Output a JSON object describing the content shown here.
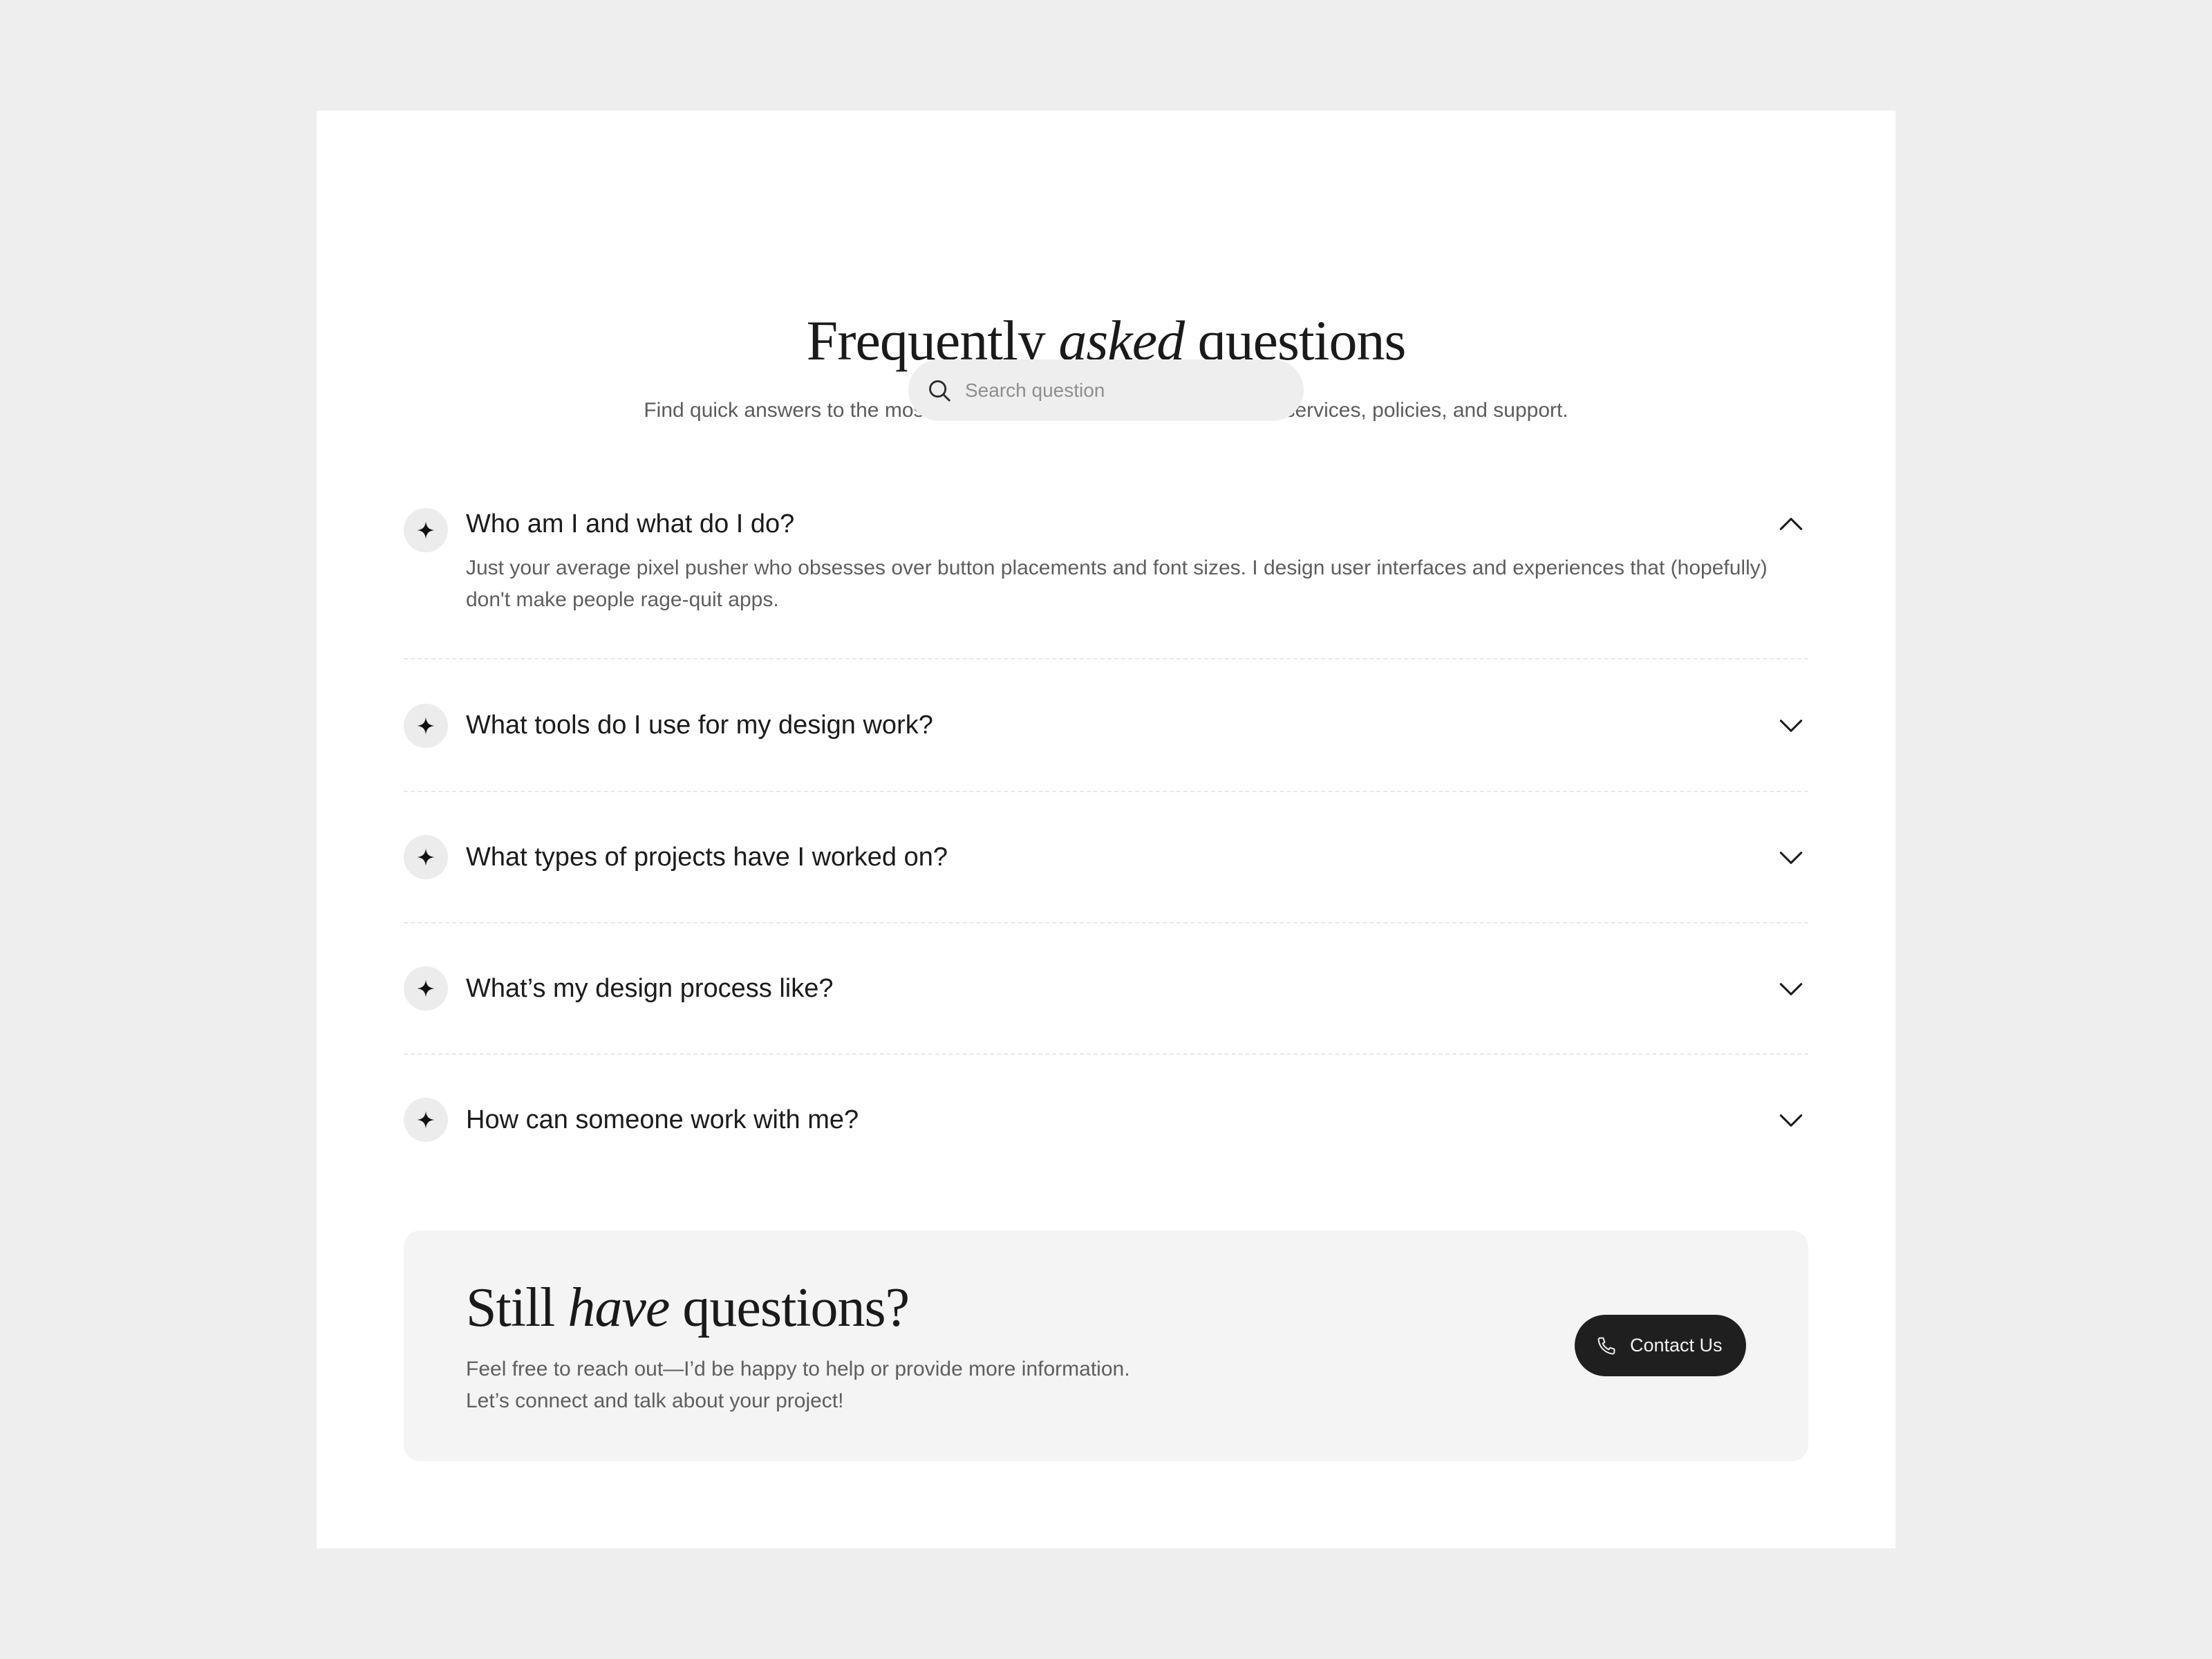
{
  "hero": {
    "title_pre": "Frequently ",
    "title_em": "asked",
    "title_post": " questions",
    "subtitle": "Find quick answers to the most commonly asked questions about our services, policies, and support."
  },
  "search": {
    "placeholder": "Search question",
    "icon": "search-icon"
  },
  "faq": {
    "item_icon": "sparkle-icon",
    "items": [
      {
        "question": "Who am I and what do I do?",
        "expanded": true,
        "answer": "Just your average pixel pusher who obsesses over button placements and font sizes. I design user interfaces and experiences that (hopefully) don't make people rage-quit apps."
      },
      {
        "question": "What tools do I use for my design work?",
        "expanded": false
      },
      {
        "question": "What types of projects have I worked on?",
        "expanded": false
      },
      {
        "question": "What’s my design process like?",
        "expanded": false
      },
      {
        "question": "How can someone work with me?",
        "expanded": false
      }
    ]
  },
  "cta": {
    "title_pre": "Still ",
    "title_em": "have",
    "title_post": " questions?",
    "line1": "Feel free to reach out—I’d be happy to help or provide more information.",
    "line2": "Let’s connect and talk about your project!",
    "button_label": "Contact Us",
    "button_icon": "phone-icon"
  },
  "colors": {
    "page_bg": "#eeeeee",
    "card_bg": "#ffffff",
    "button_bg": "#1f1f1f",
    "cta_bg": "#f4f4f4"
  }
}
